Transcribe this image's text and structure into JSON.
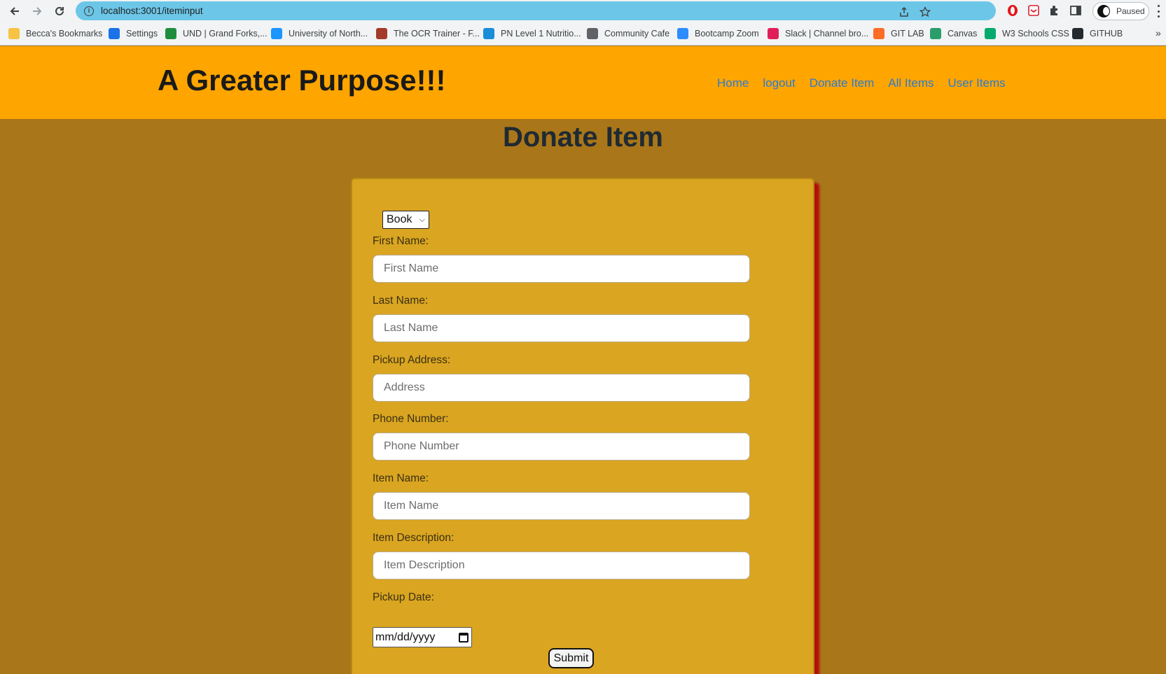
{
  "browser": {
    "url": "localhost:3001/iteminput",
    "profile_status": "Paused",
    "bookmarks": [
      {
        "label": "Becca's Bookmarks",
        "icon": "folder-icon",
        "color": "#f6c343"
      },
      {
        "label": "Settings",
        "icon": "gear-icon",
        "color": "#1a73e8"
      },
      {
        "label": "UND | Grand Forks,...",
        "icon": "und-logo-icon",
        "color": "#1e8e3e"
      },
      {
        "label": "University of North...",
        "icon": "cloud-icon",
        "color": "#1b96ff"
      },
      {
        "label": "The OCR Trainer - F...",
        "icon": "ocr-icon",
        "color": "#a23b2a"
      },
      {
        "label": "PN Level 1 Nutritio...",
        "icon": "pn-icon",
        "color": "#1a8cd8"
      },
      {
        "label": "Community Cafe",
        "icon": "chrome-icon",
        "color": "#5f6368"
      },
      {
        "label": "Bootcamp Zoom",
        "icon": "zoom-icon",
        "color": "#2d8cff"
      },
      {
        "label": "Slack | Channel bro...",
        "icon": "slack-icon",
        "color": "#e01e5a"
      },
      {
        "label": "GIT LAB",
        "icon": "gitlab-icon",
        "color": "#fc6d26"
      },
      {
        "label": "Canvas",
        "icon": "canvas-icon",
        "color": "#2a9d6b"
      },
      {
        "label": "W3 Schools CSS",
        "icon": "w3schools-icon",
        "color": "#04aa6d"
      },
      {
        "label": "GITHUB",
        "icon": "github-icon",
        "color": "#24292f"
      }
    ]
  },
  "header": {
    "title": "A Greater Purpose!!!",
    "nav": [
      "Home",
      "logout",
      "Donate Item",
      "All Items",
      "User Items"
    ]
  },
  "page": {
    "heading": "Donate Item"
  },
  "form": {
    "category": "Book",
    "fields": [
      {
        "label": "First Name:",
        "placeholder": "First Name"
      },
      {
        "label": "Last Name:",
        "placeholder": "Last Name"
      },
      {
        "label": "Pickup Address:",
        "placeholder": "Address"
      },
      {
        "label": "Phone Number:",
        "placeholder": "Phone Number"
      },
      {
        "label": "Item Name:",
        "placeholder": "Item Name"
      },
      {
        "label": "Item Description:",
        "placeholder": "Item Description"
      }
    ],
    "date_label": "Pickup Date:",
    "date_placeholder": "mm/dd/yyyy",
    "submit_label": "Submit"
  },
  "colors": {
    "header_bg": "#ffa500",
    "page_bg": "#a97619",
    "card_bg": "#daa520",
    "card_shadow": "#b40d0d",
    "nav_link": "#2a7bd1",
    "omnibox": "#6cc6e7"
  }
}
